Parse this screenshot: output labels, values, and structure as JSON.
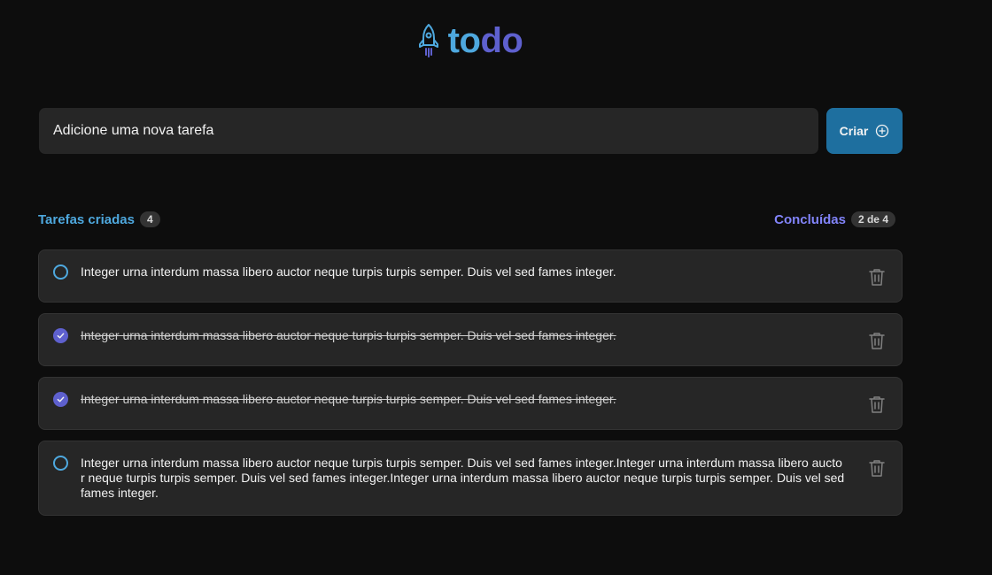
{
  "header": {
    "logo_part1": "to",
    "logo_part2": "do",
    "logo_icon": "rocket-icon",
    "colors": {
      "blue": "#4ea8de",
      "purple": "#5e60ce"
    }
  },
  "new_task": {
    "placeholder": "Adicione uma nova tarefa",
    "button_label": "Criar",
    "button_icon": "plus-circle-icon"
  },
  "counters": {
    "created_label": "Tarefas criadas",
    "created_count": "4",
    "done_label": "Concluídas",
    "done_count": "2 de 4"
  },
  "tasks": [
    {
      "text": "Integer urna interdum massa libero auctor neque turpis turpis semper. Duis vel sed fames integer.",
      "completed": false
    },
    {
      "text": "Integer urna interdum massa libero auctor neque turpis turpis semper. Duis vel sed fames integer.",
      "completed": true
    },
    {
      "text": "Integer urna interdum massa libero auctor neque turpis turpis semper. Duis vel sed fames integer.",
      "completed": true
    },
    {
      "text": "Integer urna interdum massa libero auctor neque turpis turpis semper. Duis vel sed fames integer.Integer urna interdum massa libero auctor neque turpis turpis semper. Duis vel sed fames integer.Integer urna interdum massa libero auctor neque turpis turpis semper. Duis vel sed fames integer.",
      "completed": false
    }
  ]
}
